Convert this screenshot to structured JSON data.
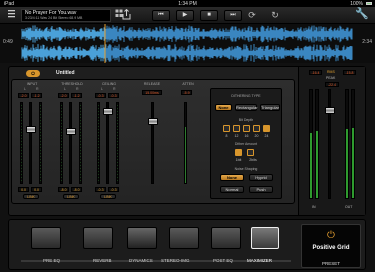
{
  "status": {
    "device": "iPad",
    "time": "1:34 PM",
    "battery": "100%"
  },
  "track": {
    "title": "No Prayer For You.wav",
    "info": "3:23/4:11  Wav 24 Bit  Stereo  68.9 MB"
  },
  "transport": {
    "rewind": "⏮",
    "play": "▶",
    "stop": "■",
    "forward": "⏭"
  },
  "timeline": {
    "start": "0:49",
    "end": "2:34"
  },
  "preset": {
    "power": "⏻",
    "name": "Untitled"
  },
  "columns": {
    "input": "INPUT",
    "threshold": "THRESHOLD",
    "ceiling": "CEILING",
    "release": "RELEASE",
    "atten": "ATTEN"
  },
  "channels": {
    "left": "L",
    "right": "R"
  },
  "values": {
    "input_l": "-2.0",
    "input_r": "-1.2",
    "threshold_l": "-2.0",
    "threshold_r": "-1.2",
    "ceiling_l": "-0.3",
    "ceiling_r": "-0.3",
    "release": "15.00ms",
    "atten": "-5.9",
    "input_bot_l": "0.0",
    "input_bot_r": "0.0",
    "threshold_bot_l": "-8.0",
    "threshold_bot_r": "-8.0",
    "ceiling_bot_l": "-0.3",
    "ceiling_bot_r": "-0.3"
  },
  "link_label": "LINK",
  "dither": {
    "title": "DITHERING TYPE",
    "types": [
      "None",
      "Rectangular",
      "Triangular"
    ],
    "bit_depth_title": "Bit Depth",
    "bit_depths": [
      "8",
      "12",
      "16",
      "20",
      "24"
    ],
    "dither_amount_title": "Dither Amount",
    "amounts": [
      "1bit",
      "2bits"
    ],
    "noise_title": "Noise Shaping",
    "noise": [
      "None",
      "Hyprid",
      "Normal",
      "Push"
    ]
  },
  "output": {
    "peaks_l": "-16.4",
    "peaks_r": "-15.8",
    "rms_label": "RMS",
    "peak_label": "PEAK",
    "rms_val": "-22.4",
    "out_l": "-0.7",
    "out_r": "-0.7",
    "in_label": "IN",
    "out_label": "OUT"
  },
  "chain": {
    "modules": [
      "PRE EQ",
      "REVERB",
      "DYNAMICS",
      "STEREO-IMG",
      "POST EQ",
      "MAXIMIZER"
    ],
    "selected": "MAXIMIZER"
  },
  "brand": {
    "name": "Positive Grid",
    "preset_label": "PRESET"
  }
}
